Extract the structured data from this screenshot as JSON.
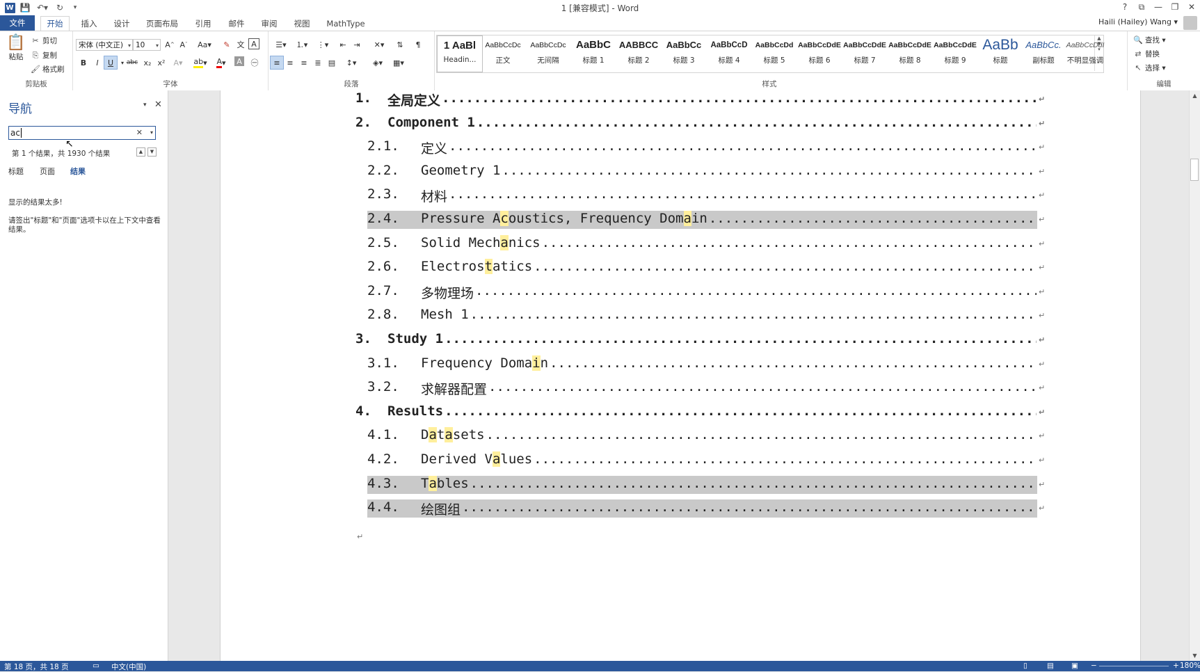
{
  "titlebar": {
    "title": "1 [兼容模式] - Word",
    "help": "?",
    "restore_icon": "ribbon-display-icon",
    "minimize": "—",
    "maximize": "❐",
    "close": "✕"
  },
  "tabs": [
    "文件",
    "开始",
    "插入",
    "设计",
    "页面布局",
    "引用",
    "邮件",
    "审阅",
    "视图",
    "MathType"
  ],
  "account": "Haili (Hailey) Wang",
  "ribbon": {
    "clipboard": {
      "paste": "粘贴",
      "cut": "剪切",
      "copy": "复制",
      "format_painter": "格式刷",
      "label": "剪贴板"
    },
    "font": {
      "name": "宋体 (中文正)",
      "size": "10",
      "label": "字体"
    },
    "paragraph": {
      "label": "段落"
    },
    "styles": {
      "label": "样式",
      "items": [
        {
          "sample": "1 AaBl",
          "name": "Headin..."
        },
        {
          "sample": "AaBbCcDc",
          "name": "正文"
        },
        {
          "sample": "AaBbCcDc",
          "name": "无间隔"
        },
        {
          "sample": "AaBbC",
          "name": "标题 1"
        },
        {
          "sample": "AABBCC",
          "name": "标题 2"
        },
        {
          "sample": "AaBbCc",
          "name": "标题 3"
        },
        {
          "sample": "AaBbCcD",
          "name": "标题 4"
        },
        {
          "sample": "AaBbCcDd",
          "name": "标题 5"
        },
        {
          "sample": "AaBbCcDdE",
          "name": "标题 6"
        },
        {
          "sample": "AaBbCcDdE",
          "name": "标题 7"
        },
        {
          "sample": "AaBbCcDdE",
          "name": "标题 8"
        },
        {
          "sample": "AaBbCcDdE",
          "name": "标题 9"
        },
        {
          "sample": "AaBb",
          "name": "标题"
        },
        {
          "sample": "AaBbCc.",
          "name": "副标题"
        },
        {
          "sample": "AaBbCcDdI",
          "name": "不明显强调"
        }
      ]
    },
    "editing": {
      "find": "查找",
      "replace": "替换",
      "select": "选择",
      "label": "编辑"
    }
  },
  "nav": {
    "title": "导航",
    "search_value": "ac",
    "result_count": "第 1 个结果，共 1930 个结果",
    "tabs": [
      "标题",
      "页面",
      "结果"
    ],
    "message1": "显示的结果太多!",
    "message2": "请签出\"标题\"和\"页面\"选项卡以在上下文中查看结果。"
  },
  "toc": [
    {
      "num": "1.",
      "text": "全局定义",
      "level": 1,
      "selected": false
    },
    {
      "num": "2.",
      "text": "Component 1",
      "level": 1,
      "selected": false
    },
    {
      "num": "2.1.",
      "text": "定义",
      "level": 2,
      "selected": false
    },
    {
      "num": "2.2.",
      "text": "Geometry 1",
      "level": 2,
      "selected": false
    },
    {
      "num": "2.3.",
      "text": "材料",
      "level": 2,
      "selected": false
    },
    {
      "num": "2.4.",
      "text": "Pressure Acoustics, Frequency Domain",
      "level": 2,
      "selected": true,
      "highlights": [
        10,
        33
      ]
    },
    {
      "num": "2.5.",
      "text": "Solid Mechanics",
      "level": 2,
      "selected": false,
      "highlights": [
        10
      ]
    },
    {
      "num": "2.6.",
      "text": "Electrostatics",
      "level": 2,
      "selected": false,
      "highlights": [
        8
      ]
    },
    {
      "num": "2.7.",
      "text": "多物理场",
      "level": 2,
      "selected": false
    },
    {
      "num": "2.8.",
      "text": "Mesh 1",
      "level": 2,
      "selected": false
    },
    {
      "num": "3.",
      "text": "Study 1",
      "level": 1,
      "selected": false
    },
    {
      "num": "3.1.",
      "text": "Frequency Domain",
      "level": 2,
      "selected": false,
      "highlights": [
        14
      ]
    },
    {
      "num": "3.2.",
      "text": "求解器配置",
      "level": 2,
      "selected": false
    },
    {
      "num": "4.",
      "text": "Results",
      "level": 1,
      "selected": false
    },
    {
      "num": "4.1.",
      "text": "Datasets",
      "level": 2,
      "selected": false,
      "highlights": [
        1,
        3
      ]
    },
    {
      "num": "4.2.",
      "text": "Derived Values",
      "level": 2,
      "selected": false,
      "highlights": [
        9
      ]
    },
    {
      "num": "4.3.",
      "text": "Tables",
      "level": 2,
      "selected": true,
      "highlights": [
        1
      ]
    },
    {
      "num": "4.4.",
      "text": "绘图组",
      "level": 2,
      "selected": true
    }
  ],
  "statusbar": {
    "page": "第 18 页，共 18 页",
    "language": "中文(中国)",
    "zoom": "180%"
  },
  "colors": {
    "accent": "#2b579a",
    "selection": "#c9c9c9",
    "highlight": "#ffef9c"
  }
}
